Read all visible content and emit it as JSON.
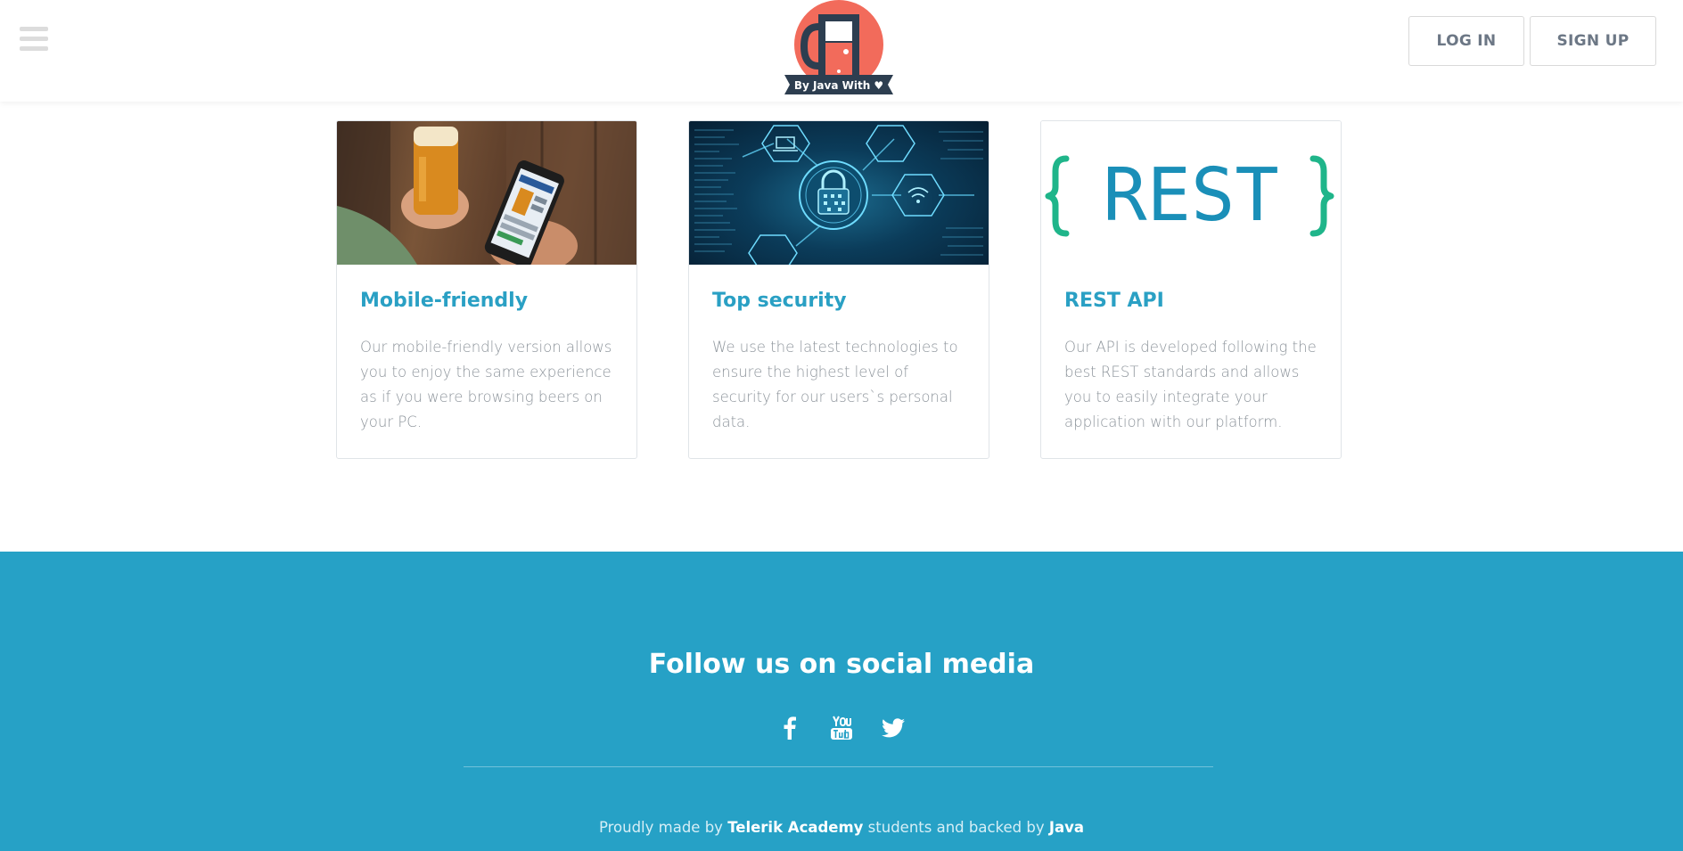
{
  "header": {
    "logo_text": "By Java With ♥",
    "login_label": "LOG IN",
    "signup_label": "SIGN UP",
    "menu_icon": "hamburger-icon"
  },
  "features": [
    {
      "title": "Mobile-friendly",
      "text": "Our mobile-friendly version allows you to enjoy the same experience as if you were browsing beers on your PC.",
      "image": "beer-and-phone-photo"
    },
    {
      "title": "Top security",
      "text": "We use the latest technologies to ensure the highest level of security for our users`s personal data.",
      "image": "security-lock-circuit-image"
    },
    {
      "title": "REST API",
      "text": "Our API is developed following the best REST standards and allows you to easily integrate your application with our platform.",
      "image": "rest-logo-image",
      "image_text": "REST"
    }
  ],
  "footer": {
    "title": "Follow us on social media",
    "socials": [
      "facebook-icon",
      "youtube-icon",
      "twitter-icon"
    ],
    "credit_prefix": "Proudly made by ",
    "credit_org": "Telerik Academy",
    "credit_middle": " students and backed by ",
    "credit_backer": "Java"
  },
  "colors": {
    "accent": "#2aa0c4",
    "footer_bg": "#26a1c6",
    "logo_coral": "#f26b5b",
    "logo_navy": "#2d3e50",
    "rest_blue": "#1a8fb8",
    "rest_green": "#1fb58a"
  }
}
